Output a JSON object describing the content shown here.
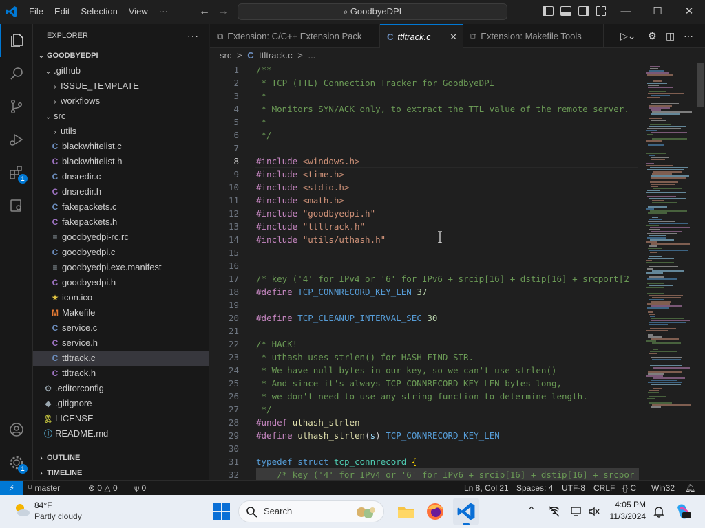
{
  "titlebar": {
    "menu": [
      "File",
      "Edit",
      "Selection",
      "View",
      "···"
    ],
    "command_center": "GoodbyeDPI",
    "minimize": "—",
    "maximize": "☐",
    "close": "✕"
  },
  "activity_bar": {
    "extensions_badge": "1",
    "accounts_badge": "1"
  },
  "sidebar": {
    "title": "EXPLORER",
    "more": "···",
    "root": "GOODBYEDPI",
    "items": [
      {
        "label": ".github",
        "kind": "folder-open",
        "depth": 1
      },
      {
        "label": "ISSUE_TEMPLATE",
        "kind": "folder",
        "depth": 2
      },
      {
        "label": "workflows",
        "kind": "folder",
        "depth": 2
      },
      {
        "label": "src",
        "kind": "folder-open",
        "depth": 1
      },
      {
        "label": "utils",
        "kind": "folder",
        "depth": 2
      },
      {
        "label": "blackwhitelist.c",
        "kind": "c",
        "depth": 2
      },
      {
        "label": "blackwhitelist.h",
        "kind": "h",
        "depth": 2
      },
      {
        "label": "dnsredir.c",
        "kind": "c",
        "depth": 2
      },
      {
        "label": "dnsredir.h",
        "kind": "h",
        "depth": 2
      },
      {
        "label": "fakepackets.c",
        "kind": "c",
        "depth": 2
      },
      {
        "label": "fakepackets.h",
        "kind": "h",
        "depth": 2
      },
      {
        "label": "goodbyedpi-rc.rc",
        "kind": "txt",
        "depth": 2
      },
      {
        "label": "goodbyedpi.c",
        "kind": "c",
        "depth": 2
      },
      {
        "label": "goodbyedpi.exe.manifest",
        "kind": "txt",
        "depth": 2
      },
      {
        "label": "goodbyedpi.h",
        "kind": "h",
        "depth": 2
      },
      {
        "label": "icon.ico",
        "kind": "star",
        "depth": 2
      },
      {
        "label": "Makefile",
        "kind": "m",
        "depth": 2
      },
      {
        "label": "service.c",
        "kind": "c",
        "depth": 2
      },
      {
        "label": "service.h",
        "kind": "h",
        "depth": 2
      },
      {
        "label": "ttltrack.c",
        "kind": "c",
        "depth": 2,
        "selected": true
      },
      {
        "label": "ttltrack.h",
        "kind": "h",
        "depth": 2
      },
      {
        "label": ".editorconfig",
        "kind": "gear",
        "depth": 1
      },
      {
        "label": ".gitignore",
        "kind": "dot",
        "depth": 1
      },
      {
        "label": "LICENSE",
        "kind": "lic",
        "depth": 1
      },
      {
        "label": "README.md",
        "kind": "info",
        "depth": 1
      }
    ],
    "sections": [
      "OUTLINE",
      "TIMELINE"
    ]
  },
  "tabs": [
    {
      "label": "Extension: C/C++ Extension Pack",
      "active": false
    },
    {
      "label": "ttltrack.c",
      "active": true,
      "close": "✕"
    },
    {
      "label": "Extension: Makefile Tools",
      "active": false
    }
  ],
  "breadcrumb": [
    "src",
    ">",
    "C",
    "ttltrack.c",
    ">",
    "..."
  ],
  "editor": {
    "current_line": 8,
    "lines": [
      {
        "n": "1",
        "t": [
          [
            "cm",
            "/**"
          ]
        ]
      },
      {
        "n": "2",
        "t": [
          [
            "cm",
            " * TCP (TTL) Connection Tracker for GoodbyeDPI"
          ]
        ]
      },
      {
        "n": "3",
        "t": [
          [
            "cm",
            " *"
          ]
        ]
      },
      {
        "n": "4",
        "t": [
          [
            "cm",
            " * Monitors SYN/ACK only, to extract the TTL value of the remote server."
          ]
        ]
      },
      {
        "n": "5",
        "t": [
          [
            "cm",
            " *"
          ]
        ]
      },
      {
        "n": "6",
        "t": [
          [
            "cm",
            " */"
          ]
        ]
      },
      {
        "n": "7",
        "t": []
      },
      {
        "n": "8",
        "t": [
          [
            "pp",
            "#include "
          ],
          [
            "st",
            "<windows.h>"
          ]
        ]
      },
      {
        "n": "9",
        "t": [
          [
            "pp",
            "#include "
          ],
          [
            "st",
            "<time.h>"
          ]
        ]
      },
      {
        "n": "10",
        "t": [
          [
            "pp",
            "#include "
          ],
          [
            "st",
            "<stdio.h>"
          ]
        ]
      },
      {
        "n": "11",
        "t": [
          [
            "pp",
            "#include "
          ],
          [
            "st",
            "<math.h>"
          ]
        ]
      },
      {
        "n": "12",
        "t": [
          [
            "pp",
            "#include "
          ],
          [
            "st",
            "\"goodbyedpi.h\""
          ]
        ]
      },
      {
        "n": "13",
        "t": [
          [
            "pp",
            "#include "
          ],
          [
            "st",
            "\"ttltrack.h\""
          ]
        ]
      },
      {
        "n": "14",
        "t": [
          [
            "pp",
            "#include "
          ],
          [
            "st",
            "\"utils/uthash.h\""
          ]
        ]
      },
      {
        "n": "15",
        "t": []
      },
      {
        "n": "16",
        "t": []
      },
      {
        "n": "17",
        "t": [
          [
            "cm",
            "/* key ('4' for IPv4 or '6' for IPv6 + srcip[16] + dstip[16] + srcport[2"
          ]
        ]
      },
      {
        "n": "18",
        "t": [
          [
            "pp",
            "#define "
          ],
          [
            "mac",
            "TCP_CONNRECORD_KEY_LEN "
          ],
          [
            "num",
            "37"
          ]
        ]
      },
      {
        "n": "19",
        "t": []
      },
      {
        "n": "20",
        "t": [
          [
            "pp",
            "#define "
          ],
          [
            "mac",
            "TCP_CLEANUP_INTERVAL_SEC "
          ],
          [
            "num",
            "30"
          ]
        ]
      },
      {
        "n": "21",
        "t": []
      },
      {
        "n": "22",
        "t": [
          [
            "cm",
            "/* HACK!"
          ]
        ]
      },
      {
        "n": "23",
        "t": [
          [
            "cm",
            " * uthash uses strlen() for HASH_FIND_STR."
          ]
        ]
      },
      {
        "n": "24",
        "t": [
          [
            "cm",
            " * We have null bytes in our key, so we can't use strlen()"
          ]
        ]
      },
      {
        "n": "25",
        "t": [
          [
            "cm",
            " * And since it's always TCP_CONNRECORD_KEY_LEN bytes long,"
          ]
        ]
      },
      {
        "n": "26",
        "t": [
          [
            "cm",
            " * we don't need to use any string function to determine length."
          ]
        ]
      },
      {
        "n": "27",
        "t": [
          [
            "cm",
            " */"
          ]
        ]
      },
      {
        "n": "28",
        "t": [
          [
            "pp",
            "#undef "
          ],
          [
            "fn",
            "uthash_strlen"
          ]
        ]
      },
      {
        "n": "29",
        "t": [
          [
            "pp",
            "#define "
          ],
          [
            "fn",
            "uthash_strlen"
          ],
          [
            "x",
            "("
          ],
          [
            "id",
            "s"
          ],
          [
            "x",
            ") "
          ],
          [
            "mac",
            "TCP_CONNRECORD_KEY_LEN"
          ]
        ]
      },
      {
        "n": "30",
        "t": []
      },
      {
        "n": "31",
        "t": [
          [
            "kw",
            "typedef "
          ],
          [
            "kw",
            "struct "
          ],
          [
            "ty",
            "tcp_connrecord "
          ],
          [
            "br",
            "{"
          ]
        ]
      },
      {
        "n": "32",
        "t": [
          [
            "cm",
            "    /* key ('4' for IPv4 or '6' for IPv6 + srcip[16] + dstip[16] + srcpor"
          ]
        ]
      }
    ]
  },
  "statusbar": {
    "remote": "⚡",
    "branch": "master",
    "errors": "0",
    "warnings": "0",
    "ports": "0",
    "position": "Ln 8, Col 21",
    "spaces": "Spaces: 4",
    "encoding": "UTF-8",
    "eol": "CRLF",
    "language": "C",
    "config": "Win32"
  },
  "taskbar": {
    "temperature": "84°F",
    "condition": "Partly cloudy",
    "search_label": "Search",
    "time": "4:05 PM",
    "date": "11/3/2024"
  },
  "colors": {
    "accent": "#0078d4",
    "comment": "#6a9955",
    "preprocessor": "#c586c0",
    "string": "#ce9178"
  }
}
